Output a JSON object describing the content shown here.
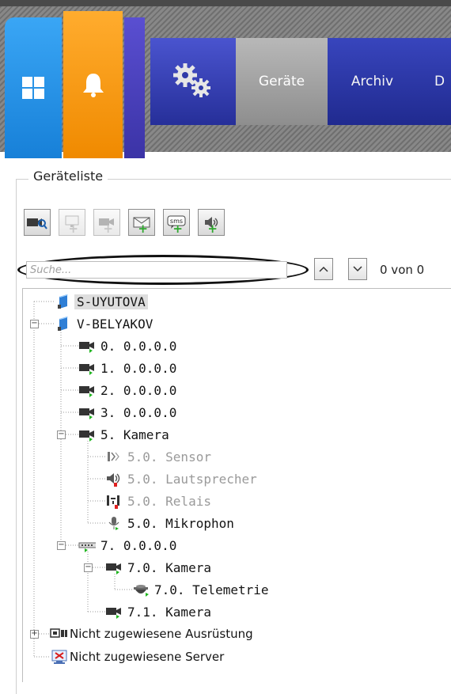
{
  "nav": {
    "tabs": [
      {
        "label": "Geräte",
        "active": true
      },
      {
        "label": "Archiv",
        "active": false
      },
      {
        "label": "D",
        "active": false
      }
    ]
  },
  "devices_panel": {
    "title": "Geräteliste",
    "toolbar": [
      {
        "icon": "camera-search-icon",
        "enabled": true
      },
      {
        "icon": "add-monitor-icon",
        "enabled": false
      },
      {
        "icon": "add-camera-icon",
        "enabled": false
      },
      {
        "icon": "add-email-icon",
        "enabled": true
      },
      {
        "icon": "add-sms-icon",
        "enabled": true
      },
      {
        "icon": "add-speaker-icon",
        "enabled": true
      }
    ],
    "search": {
      "placeholder": "Suche...",
      "value": ""
    },
    "counter": "0 von 0"
  },
  "tree": [
    {
      "label": "S-UYUTOVA",
      "icon": "server-icon",
      "level": 0,
      "selected": true
    },
    {
      "label": "V-BELYAKOV",
      "icon": "server-icon",
      "level": 0,
      "expanded": true
    },
    {
      "label": "0. 0.0.0.0",
      "icon": "camera-icon",
      "level": 1
    },
    {
      "label": "1. 0.0.0.0",
      "icon": "camera-icon",
      "level": 1
    },
    {
      "label": "2. 0.0.0.0",
      "icon": "camera-icon",
      "level": 1
    },
    {
      "label": "3. 0.0.0.0",
      "icon": "camera-icon",
      "level": 1
    },
    {
      "label": "5. Kamera",
      "icon": "camera-icon",
      "level": 1,
      "expanded": true
    },
    {
      "label": "5.0. Sensor",
      "icon": "sensor-icon",
      "level": 2,
      "disabled": true
    },
    {
      "label": "5.0. Lautsprecher",
      "icon": "speaker-icon",
      "level": 2,
      "disabled": true
    },
    {
      "label": "5.0. Relais",
      "icon": "relay-icon",
      "level": 2,
      "disabled": true
    },
    {
      "label": "5.0. Mikrophon",
      "icon": "microphone-icon",
      "level": 2
    },
    {
      "label": "7. 0.0.0.0",
      "icon": "encoder-icon",
      "level": 1,
      "expanded": true
    },
    {
      "label": "7.0. Kamera",
      "icon": "camera-icon",
      "level": 2,
      "expanded": true
    },
    {
      "label": "7.0. Telemetrie",
      "icon": "ptz-dome-icon",
      "level": 3
    },
    {
      "label": "7.1. Kamera",
      "icon": "camera-icon",
      "level": 2
    },
    {
      "label": "Nicht zugewiesene Ausrüstung",
      "icon": "unassigned-equipment-icon",
      "level": 0,
      "collapsed": true
    },
    {
      "label": "Nicht zugewiesene Server",
      "icon": "unassigned-server-icon",
      "level": 0
    }
  ],
  "colors": {
    "tile_blue": "#2a93ea",
    "tile_orange": "#f59a12",
    "nav_blue": "#2a34a3",
    "active_tab": "#a6a6a6"
  }
}
